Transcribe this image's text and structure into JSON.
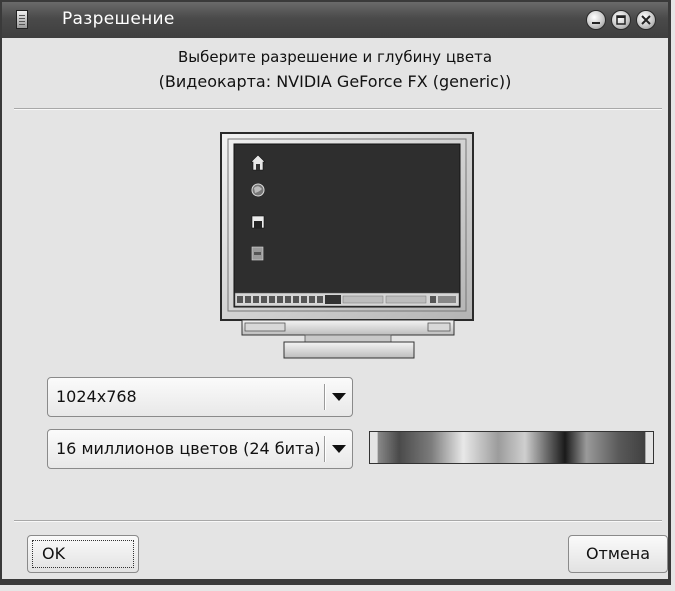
{
  "window": {
    "title": "Разрешение"
  },
  "header": {
    "line1": "Выберите разрешение и глубину цвета",
    "line2": "(Видеокарта: NVIDIA GeForce FX (generic))"
  },
  "monitor_preview": {
    "desktop_icons": [
      "home-icon",
      "globe-icon",
      "floppy-disk-icon",
      "trash-icon"
    ]
  },
  "resolution_select": {
    "value": "1024x768"
  },
  "color_depth_select": {
    "value": "16 миллионов цветов (24 бита)"
  },
  "buttons": {
    "ok": "OK",
    "cancel": "Отмена"
  },
  "colors": {
    "titlebar": "#4a4a4a",
    "screen": "#2e2e2e",
    "dialog_bg": "#e4e4e4"
  }
}
